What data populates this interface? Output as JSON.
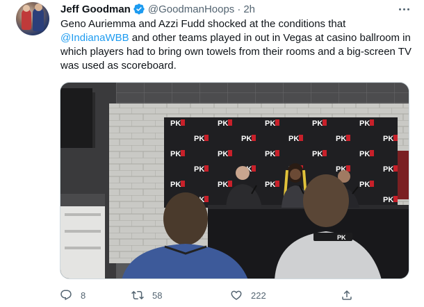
{
  "tweet": {
    "author_name": "Jeff Goodman",
    "author_handle": "@GoodmanHoops",
    "separator": "·",
    "timestamp": "2h",
    "text_before": "Geno Auriemma and Azzi Fudd shocked at the conditions that ",
    "mention": "@IndianaWBB",
    "text_after": " and other teams played in out in Vegas at casino ballroom in which players had to bring own towels from their rooms and a big-screen TV was used as scoreboard.",
    "media_logo_text": "PK",
    "lanyard_text": "PK"
  },
  "actions": {
    "reply_count": "8",
    "retweet_count": "58",
    "like_count": "222"
  },
  "colors": {
    "accent": "#1d9bf0",
    "secondary_text": "#536471",
    "primary_text": "#0f1419"
  },
  "icons": [
    "verified-badge-icon",
    "more-options-icon",
    "reply-icon",
    "retweet-icon",
    "like-icon",
    "share-icon"
  ]
}
